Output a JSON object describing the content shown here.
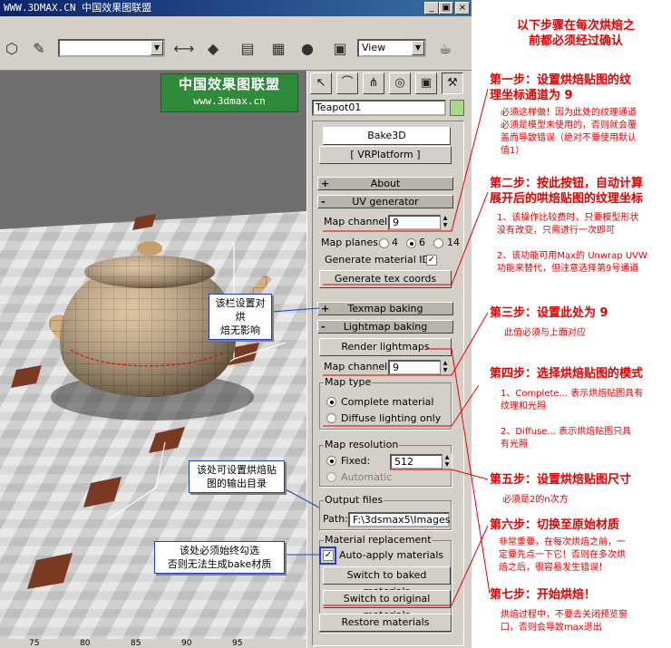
{
  "window": {
    "title": "WWW.3DMAX.CN 中国效果图联盟",
    "buttons": [
      "_",
      "▣",
      "×"
    ]
  },
  "toolbar": {
    "view_label": "View"
  },
  "banner": {
    "line1": "中国效果图联盟",
    "line2": "www.3dmax.cn"
  },
  "panel": {
    "object_name": "Teapot01",
    "bake3d_label": "Bake3D",
    "vrplatform_label": "[ VRPlatform ]",
    "about_label": "About",
    "uv_generator_label": "UV generator",
    "map_channel_label": "Map channel:",
    "map_channel_value": "9",
    "map_planes_label": "Map planes:",
    "map_planes_options": [
      "4",
      "6",
      "14"
    ],
    "gen_mat_ids_label": "Generate material IDs:",
    "gen_tex_coords_label": "Generate tex coords",
    "texmap_baking_label": "Texmap baking",
    "lightmap_baking_label": "Lightmap baking",
    "render_lightmaps_label": "Render lightmaps",
    "map_channel2_label": "Map channel:",
    "map_channel2_value": "9",
    "map_type_label": "Map type",
    "complete_material_label": "Complete material",
    "diffuse_lighting_label": "Diffuse lighting only",
    "map_resolution_label": "Map resolution",
    "fixed_label": "Fixed:",
    "fixed_value": "512",
    "automatic_label": "Automatic",
    "output_files_label": "Output files",
    "path_label": "Path:",
    "path_value": "F:\\3dsmax5\\Images",
    "material_replacement_label": "Material replacement",
    "auto_apply_label": "Auto-apply materials",
    "switch_baked_label": "Switch to baked materials",
    "switch_original_label": "Switch to original materials",
    "restore_materials_label": "Restore materials"
  },
  "ruler": {
    "ticks": [
      "75",
      "80",
      "85",
      "90",
      "95"
    ]
  },
  "annotations": {
    "header": [
      "以下步骤在每次烘焙之",
      "前都必须经过确认"
    ],
    "step1_title": [
      "第一步：设置烘焙贴图的纹",
      "理坐标通道为 9"
    ],
    "step1_desc": [
      "必须这样做！因为此处的纹理通道",
      "必须是模型未使用的，否则就会覆",
      "盖而导致错误（绝对不要使用默认",
      "值1）"
    ],
    "step2_title": [
      "第二步：按此按钮，自动计算",
      "展开后的哄焙贴图的纹理坐标"
    ],
    "step2_desc1": [
      "1、该操作比较费时，只要模型形状",
      "没有改变，只需进行一次即可"
    ],
    "step2_desc2": [
      "2、该功能可用Max的 Unwrap UVW",
      "功能来替代，但注意选择第9号通道"
    ],
    "step3_title": "第三步：设置此处为 9",
    "step3_desc": "此值必须与上面对应",
    "step4_title": "第四步：选择烘焙贴图的模式",
    "step4_desc1": [
      "1、Complete... 表示烘焙贴图具有",
      "纹理和光照"
    ],
    "step4_desc2": [
      "2、Diffuse... 表示烘焙贴图只具",
      "有光照"
    ],
    "step5_title": "第五步：设置烘焙贴图尺寸",
    "step5_desc": "必须是2的n次方",
    "step6_title": "第六步：切换至原始材质",
    "step6_desc": [
      "非常重要，在每次烘焙之前，一",
      "定要先点一下它！否则在多次烘",
      "焙之后，很容易发生错误！"
    ],
    "step7_title": "第七步：开始烘焙！",
    "step7_desc": [
      "烘焙过程中，不要去关闭预览窗",
      "口，否则会导致max退出"
    ],
    "note_texmap": [
      "该栏设置对烘",
      "焙无影响"
    ],
    "note_output": [
      "该处可设置烘焙贴",
      "图的输出目录"
    ],
    "note_autoapply": [
      "该处必须始终勾选",
      "否则无法生成bake材质"
    ]
  },
  "colors": {
    "annotation_red": "#e00000",
    "note_border": "#2040c0",
    "banner_green": "#2e8b3a",
    "panel_bg": "#d4d0c8"
  }
}
